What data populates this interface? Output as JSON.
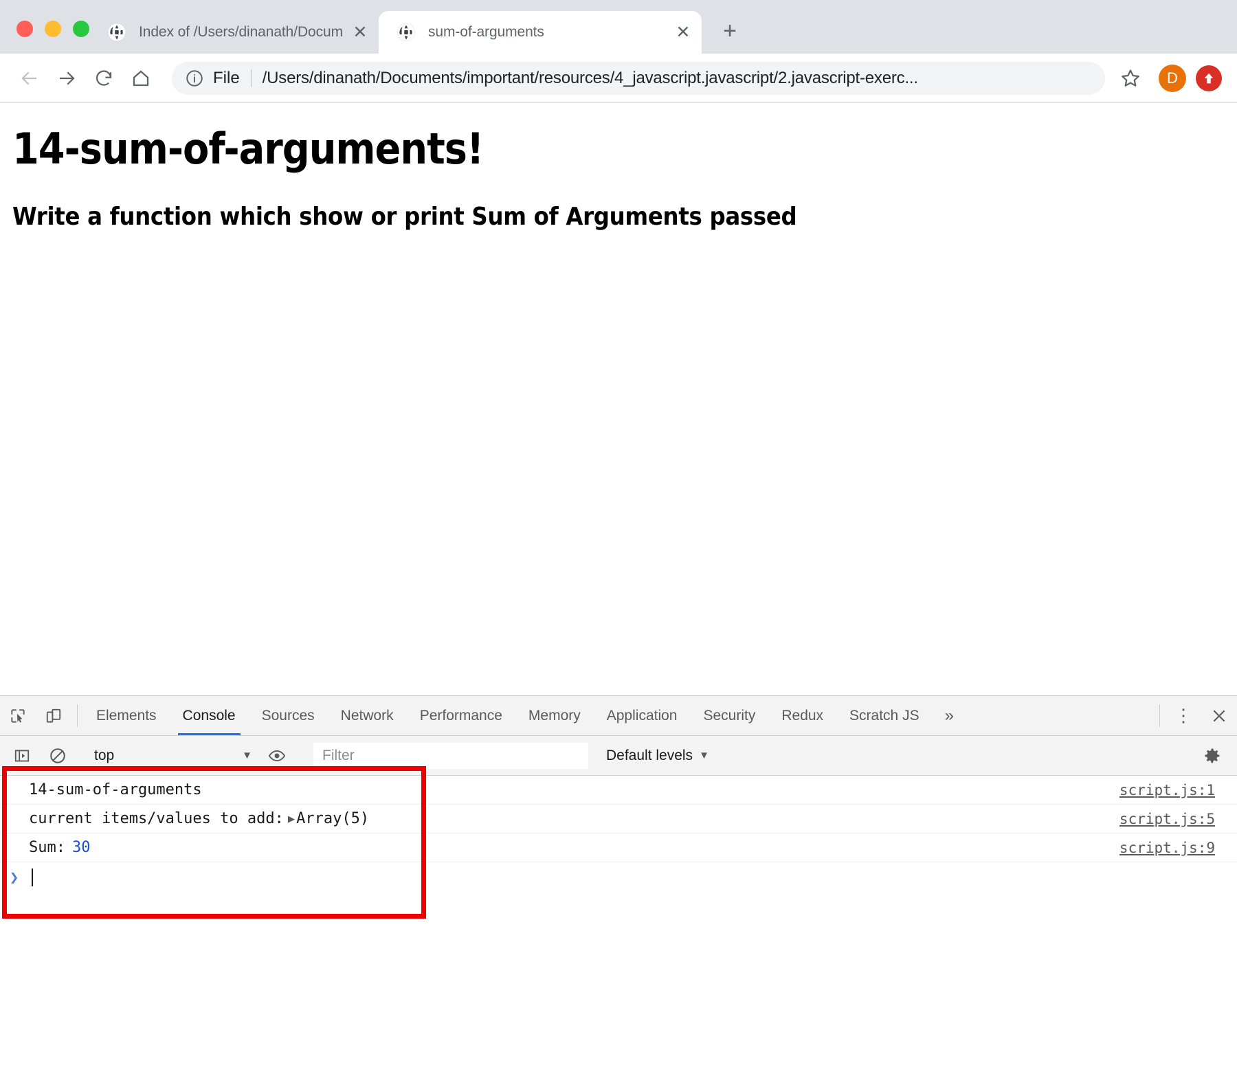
{
  "browser": {
    "tabs": [
      {
        "title": "Index of /Users/dinanath/Docum",
        "favicon": "globe-icon",
        "active": false
      },
      {
        "title": "sum-of-arguments",
        "favicon": "globe-icon",
        "active": true
      }
    ],
    "new_tab_label": "+",
    "close_label": "✕",
    "toolbar": {
      "back_label": "←",
      "forward_label": "→",
      "reload_label": "⟳",
      "home_label": "⌂",
      "scheme_label": "File",
      "url": "/Users/dinanath/Documents/important/resources/4_javascript.javascript/2.javascript-exerc...",
      "bookmark_icon": "star-icon",
      "avatar_label": "D",
      "avatar_color": "#e8710a",
      "update_color": "#d93025"
    }
  },
  "page": {
    "heading": "14-sum-of-arguments!",
    "subheading": "Write a function which show or print Sum of Arguments passed"
  },
  "devtools": {
    "inspect_icon": "inspect-element-icon",
    "device_icon": "device-toolbar-icon",
    "tabs": [
      {
        "label": "Elements",
        "active": false
      },
      {
        "label": "Console",
        "active": true
      },
      {
        "label": "Sources",
        "active": false
      },
      {
        "label": "Network",
        "active": false
      },
      {
        "label": "Performance",
        "active": false
      },
      {
        "label": "Memory",
        "active": false
      },
      {
        "label": "Application",
        "active": false
      },
      {
        "label": "Security",
        "active": false
      },
      {
        "label": "Redux",
        "active": false
      },
      {
        "label": "Scratch JS",
        "active": false
      }
    ],
    "more_tabs_label": "»",
    "kebab_label": "⋮",
    "close_label": "✕",
    "console_toolbar": {
      "sidebar_icon": "console-sidebar-icon",
      "clear_icon": "clear-console-icon",
      "context": "top",
      "context_caret": "▼",
      "eye_icon": "live-expression-icon",
      "filter_placeholder": "Filter",
      "filter_value": "",
      "levels": "Default levels",
      "levels_caret": "▼",
      "settings_icon": "gear-icon"
    },
    "console_messages": [
      {
        "text": "14-sum-of-arguments",
        "source": "script.js:1",
        "type": "log"
      },
      {
        "text": "current items/values to add:",
        "object": "Array(5)",
        "arrow": "▶",
        "source": "script.js:5",
        "type": "log"
      },
      {
        "text": "Sum:",
        "value": "30",
        "source": "script.js:9",
        "type": "log"
      }
    ],
    "prompt": {
      "chevron": "❯",
      "value": ""
    },
    "annotation": {
      "color": "#ee0000",
      "shape": "rectangle"
    }
  }
}
